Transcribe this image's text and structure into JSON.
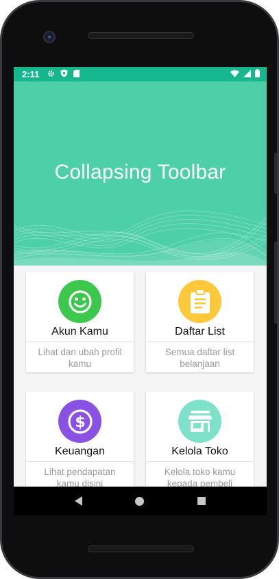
{
  "status_bar": {
    "time": "2:11",
    "icons_left": [
      "gear-icon",
      "shield-icon",
      "sim-card-icon"
    ],
    "icons_right": [
      "wifi-icon",
      "signal-icon",
      "battery-icon"
    ],
    "color": "#17b78d"
  },
  "toolbar": {
    "title": "Collapsing Toolbar",
    "color": "#4dcfa8"
  },
  "cards": [
    {
      "title": "Akun Kamu",
      "description": "Lihat dan ubah profil kamu",
      "icon": "smiley-face-icon",
      "color": "#3cc74d"
    },
    {
      "title": "Daftar List",
      "description": "Semua daftar list belanjaan",
      "icon": "clipboard-list-icon",
      "color": "#fdc83a"
    },
    {
      "title": "Keuangan",
      "description": "Lihat pendapatan kamu disini",
      "icon": "dollar-icon",
      "color": "#8a52e4"
    },
    {
      "title": "Kelola Toko",
      "description": "Kelola toko kamu kepada pembeli",
      "icon": "store-icon",
      "color": "#7ee1c9"
    }
  ],
  "nav_bar": {
    "buttons": [
      "back-icon",
      "home-icon",
      "recents-icon"
    ]
  }
}
